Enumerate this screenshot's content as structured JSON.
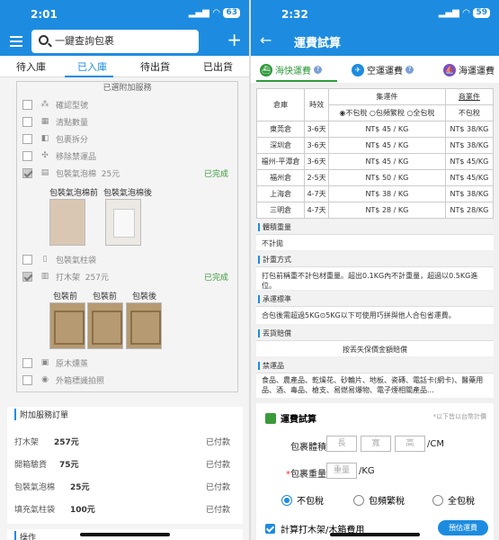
{
  "left": {
    "status": {
      "time": "2:01",
      "battery": "63"
    },
    "search_placeholder": "一鍵查詢包裹",
    "tabs": [
      "待入庫",
      "已入庫",
      "待出貨",
      "已出貨"
    ],
    "services_title": "已選附加服務",
    "services": [
      {
        "label": "確認型號",
        "icon": "cubes-icon",
        "checked": false,
        "done": ""
      },
      {
        "label": "清點數量",
        "icon": "grid-icon",
        "checked": false,
        "done": ""
      },
      {
        "label": "包裹拆分",
        "icon": "split-icon",
        "checked": false,
        "done": ""
      },
      {
        "label": "移除禁運品",
        "icon": "remove-icon",
        "checked": false,
        "done": ""
      },
      {
        "label": "包裝氣泡棉",
        "price": "25元",
        "icon": "bubble-wrap-icon",
        "checked": true,
        "done": "已完成"
      },
      {
        "label": "包裝氣柱袋",
        "icon": "air-bag-icon",
        "checked": false,
        "done": ""
      },
      {
        "label": "打木架",
        "price": "257元",
        "icon": "wood-frame-icon",
        "checked": true,
        "done": "已完成"
      },
      {
        "label": "原木燻蒸",
        "icon": "fumigation-icon",
        "checked": false,
        "done": ""
      },
      {
        "label": "外箱標識拍照",
        "icon": "camera-icon",
        "checked": false,
        "done": ""
      }
    ],
    "bubble_photos": [
      "包裝氣泡棉前",
      "包裝氣泡棉後"
    ],
    "wood_photos": [
      "包裝前",
      "包裝前",
      "包裝後"
    ],
    "orders_title": "附加服務訂單",
    "orders": [
      {
        "name": "打木架",
        "price": "257元",
        "status": "已付款"
      },
      {
        "name": "開箱驗貨",
        "price": "75元",
        "status": "已付款"
      },
      {
        "name": "包裝氣泡棉",
        "price": "25元",
        "status": "已付款"
      },
      {
        "name": "填充氣柱袋",
        "price": "100元",
        "status": "已付款"
      }
    ],
    "ops_title": "操作"
  },
  "right": {
    "status": {
      "time": "2:32",
      "battery": "59"
    },
    "title": "運費試算",
    "ship_tabs": [
      "海快運費",
      "空運運費",
      "海運運費"
    ],
    "table": {
      "headers": [
        "倉庫",
        "時效",
        "集運件",
        "商業件"
      ],
      "tax_options": [
        "不包稅",
        "包頻繁稅",
        "全包稅"
      ],
      "commercial_sub": "不包稅",
      "rows": [
        [
          "東莞倉",
          "3-6天",
          "NT$ 45 / KG",
          "NT$ 38/KG"
        ],
        [
          "深圳倉",
          "3-6天",
          "NT$ 45 / KG",
          "NT$ 38/KG"
        ],
        [
          "福州-平潭倉",
          "3-6天",
          "NT$ 45 / KG",
          "NT$ 45/KG"
        ],
        [
          "福州倉",
          "2-5天",
          "NT$ 50 / KG",
          "NT$ 45/KG"
        ],
        [
          "上海倉",
          "4-7天",
          "NT$ 38 / KG",
          "NT$ 38/KG"
        ],
        [
          "三明倉",
          "4-7天",
          "NT$ 28 / KG",
          "NT$ 28/KG"
        ]
      ]
    },
    "sections": [
      {
        "title": "體積重量",
        "body": "不計拋"
      },
      {
        "title": "計重方式",
        "body": "打包前稱重不計包材重量。超出0.1KG內不計重量，超過以0.5KG進位。"
      },
      {
        "title": "承運標準",
        "body": "合包後需超過5KG⊙5KG以下可使用巧拼與他人合包省運費。"
      },
      {
        "title": "丟貨賠償",
        "body": "按丟失保價金額賠償"
      },
      {
        "title": "禁運品",
        "body": "食品、農產品、乾燥花、砂輪片、地板、瓷磚、電話卡(網卡)、醫藥用品、酒、毒品、槍支、易燃易爆物、電子煙相關產品..."
      }
    ],
    "calc": {
      "title": "運費試算",
      "note": "*以下皆以台幣計價",
      "volume_label": "包裹體積",
      "dims": [
        "長",
        "寬",
        "高"
      ],
      "volume_unit": "/CM",
      "weight_label": "包裹重量",
      "weight_placeholder": "重量",
      "weight_unit": "/KG",
      "tax_options": [
        "不包稅",
        "包頻繁稅",
        "全包稅"
      ],
      "wood_option": "計算打木架/木箱費用",
      "estimate_btn": "預估運費"
    }
  }
}
